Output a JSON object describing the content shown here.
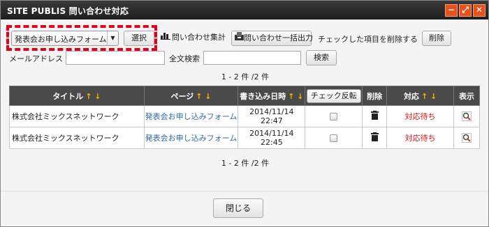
{
  "window": {
    "title": "SITE PUBLIS 問い合わせ対応",
    "minimize_label": "−",
    "maximize_label": "⤢",
    "close_label": "✕"
  },
  "toolbar": {
    "form_select_value": "発表会お申し込みフォーム",
    "select_button": "選択",
    "summary_button": "問い合わせ集計",
    "export_button": "問い合わせ一括出力",
    "delete_checked_label": "チェックした項目を削除する",
    "delete_button": "削除"
  },
  "search": {
    "email_label": "メールアドレス",
    "email_value": "",
    "fulltext_label": "全文検索",
    "fulltext_value": "",
    "search_button": "検索"
  },
  "pager": {
    "top": "1 - 2 件 /2 件",
    "bottom": "1 - 2 件 /2 件"
  },
  "table": {
    "headers": {
      "title": "タイトル",
      "page": "ページ",
      "datetime": "書き込み日時",
      "toggle_check": "チェック反転",
      "delete": "削除",
      "status": "対応",
      "view": "表示"
    },
    "sort_arrows": "↑ ↓",
    "rows": [
      {
        "title": "株式会社ミックスネットワーク",
        "page": "発表会お申し込みフォーム",
        "date": "2014/11/14",
        "time": "22:47",
        "status": "対応待ち"
      },
      {
        "title": "株式会社ミックスネットワーク",
        "page": "発表会お申し込みフォーム",
        "date": "2014/11/14",
        "time": "22:45",
        "status": "対応待ち"
      }
    ]
  },
  "footer": {
    "close_button": "閉じる"
  },
  "colors": {
    "accent_orange": "#e8511c",
    "highlight_red": "#e3001b",
    "status_red": "#e01010",
    "link_blue": "#2c6aa6",
    "sort_arrow": "#f5b400"
  }
}
